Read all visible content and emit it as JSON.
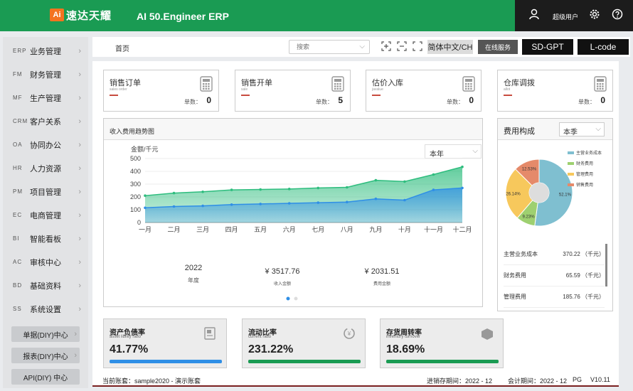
{
  "topbar": {
    "logo_badge": "Ai",
    "logo_text": "速达天耀",
    "app_title": "AI 50.Engineer ERP",
    "user_label": "超级用户",
    "user_icon": "user-icon",
    "settings_icon": "gear-icon",
    "help_icon": "help-icon"
  },
  "sidebar": {
    "items": [
      {
        "code": "ERP",
        "label": "业务管理"
      },
      {
        "code": "FM",
        "label": "财务管理"
      },
      {
        "code": "MF",
        "label": "生产管理"
      },
      {
        "code": "CRM",
        "label": "客户关系"
      },
      {
        "code": "OA",
        "label": "协同办公"
      },
      {
        "code": "HR",
        "label": "人力资源"
      },
      {
        "code": "PM",
        "label": "项目管理"
      },
      {
        "code": "EC",
        "label": "电商管理"
      },
      {
        "code": "BI",
        "label": "智能看板"
      },
      {
        "code": "AC",
        "label": "审核中心"
      },
      {
        "code": "BD",
        "label": "基础资料"
      },
      {
        "code": "SS",
        "label": "系统设置"
      }
    ],
    "buttons": [
      "单据(DIY)中心",
      "报表(DIY)中心",
      "API(DIY) 中心"
    ]
  },
  "toolbar": {
    "home_tab": "首页",
    "search_placeholder": "搜索",
    "lang_btn": "简体中文/CH",
    "online_btn": "在线服务",
    "sd_gpt_btn": "SD-GPT",
    "lcode_btn": "L-code"
  },
  "cards": [
    {
      "title": "销售订单",
      "sub": "sales order",
      "count_label": "单数：",
      "count": "0"
    },
    {
      "title": "销售开单",
      "sub": "sale",
      "count_label": "单数：",
      "count": "5"
    },
    {
      "title": "估价入库",
      "sub": "javalue",
      "count_label": "单数：",
      "count": "0"
    },
    {
      "title": "仓库调拨",
      "sub": "allot",
      "count_label": "单数：",
      "count": "0"
    }
  ],
  "trend": {
    "panel_title": "收入费用趋势图",
    "range": "本年",
    "year": "2022",
    "year_label": "年度",
    "income_value": "¥ 3517.76",
    "income_label": "收入金额",
    "expense_value": "¥ 2031.51",
    "expense_label": "费用金额"
  },
  "chart_data": {
    "type": "area",
    "ylabel": "金额/千元",
    "ylim": [
      0,
      500
    ],
    "yticks": [
      "0",
      "100",
      "200",
      "300",
      "400",
      "500"
    ],
    "categories": [
      "一月",
      "二月",
      "三月",
      "四月",
      "五月",
      "六月",
      "七月",
      "八月",
      "九月",
      "十月",
      "十一月",
      "十二月"
    ],
    "series": [
      {
        "name": "",
        "color": "#2ebd7e",
        "values": [
          210,
          230,
          240,
          255,
          258,
          262,
          270,
          275,
          330,
          320,
          375,
          435
        ]
      },
      {
        "name": "",
        "color": "#2f8fe6",
        "values": [
          115,
          125,
          130,
          140,
          145,
          150,
          155,
          160,
          185,
          175,
          255,
          270
        ]
      }
    ],
    "grid": true
  },
  "expense": {
    "title": "费用构成",
    "range": "本季",
    "pie": {
      "type": "pie",
      "slices": [
        {
          "name": "主营业务成本",
          "value": 52.1,
          "label": "52.1%",
          "color": "#7fbfd0"
        },
        {
          "name": "财务费用",
          "value": 9.23,
          "label": "9.23%",
          "color": "#9ed070"
        },
        {
          "name": "管理费用",
          "value": 26.14,
          "label": "26.14%",
          "color": "#f7c85c"
        },
        {
          "name": "销售费用",
          "value": 12.53,
          "label": "12.53%",
          "color": "#e58a6a"
        }
      ]
    },
    "rows": [
      {
        "name": "主营业务成本",
        "value": "370.22 （千元）"
      },
      {
        "name": "财务费用",
        "value": "65.59 （千元）"
      },
      {
        "name": "管理费用",
        "value": "185.76 （千元）"
      }
    ]
  },
  "kpis": [
    {
      "title": "资产负债率",
      "sub": "asset libility ratio",
      "value": "41.77%",
      "percent": 100,
      "color": "#2f8fe6"
    },
    {
      "title": "流动比率",
      "sub": "current ratio",
      "value": "231.22%",
      "percent": 100,
      "color": "#1a9b53"
    },
    {
      "title": "存货周转率",
      "sub": "inventory turnover",
      "value": "18.69%",
      "percent": 100,
      "color": "#1a9b53"
    }
  ],
  "footer": {
    "account": "当前账套：sample2020 - 演示账套",
    "inv_period": "进销存期间：2022 - 12",
    "acc_period": "会计期间：2022 - 12",
    "pg": "PG",
    "version": "V10.11"
  }
}
